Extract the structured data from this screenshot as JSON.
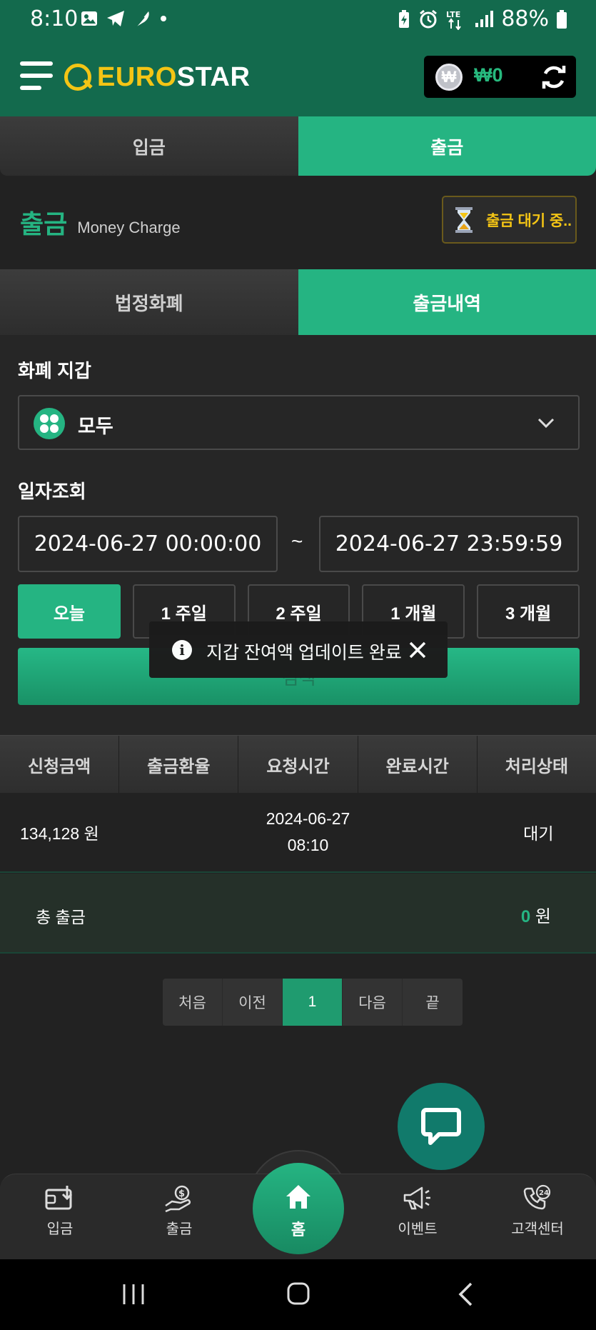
{
  "status_bar": {
    "time": "8:10",
    "battery": "88%"
  },
  "header": {
    "logo_left": "EURO",
    "logo_right": "STAR",
    "balance": "₩0",
    "currency_symbol": "₩"
  },
  "main_tabs": {
    "deposit": "입금",
    "withdraw": "출금"
  },
  "section": {
    "title": "출금",
    "subtitle": "Money Charge",
    "pending_button": "출금 대기 중.."
  },
  "sub_tabs": {
    "fiat": "법정화폐",
    "history": "출금내역"
  },
  "filters": {
    "wallet_label": "화폐 지갑",
    "wallet_value": "모두",
    "date_label": "일자조회",
    "date_from": "2024-06-27 00:00:00",
    "date_sep": "~",
    "date_to": "2024-06-27 23:59:59",
    "periods": [
      "오늘",
      "1 주일",
      "2 주일",
      "1 개월",
      "3 개월"
    ],
    "search": "검색"
  },
  "toast": {
    "text": "지갑 잔여액 업데이트 완료"
  },
  "table": {
    "headers": [
      "신청금액",
      "출금환율",
      "요청시간",
      "완료시간",
      "처리상태"
    ],
    "rows": [
      {
        "amount": "134,128 원",
        "rate": "",
        "request_date": "2024-06-27",
        "request_time": "08:10",
        "complete": "",
        "status": "대기"
      }
    ],
    "total_label": "총 출금",
    "total_value": "0",
    "total_unit": "원"
  },
  "pager": {
    "first": "처음",
    "prev": "이전",
    "current": "1",
    "next": "다음",
    "last": "끝"
  },
  "bottom_nav": {
    "deposit": "입금",
    "withdraw": "출금",
    "home": "홈",
    "event": "이벤트",
    "support": "고객센터"
  },
  "colors": {
    "accent": "#25b482",
    "header_bg": "#136a4d",
    "gold": "#f4c515"
  }
}
